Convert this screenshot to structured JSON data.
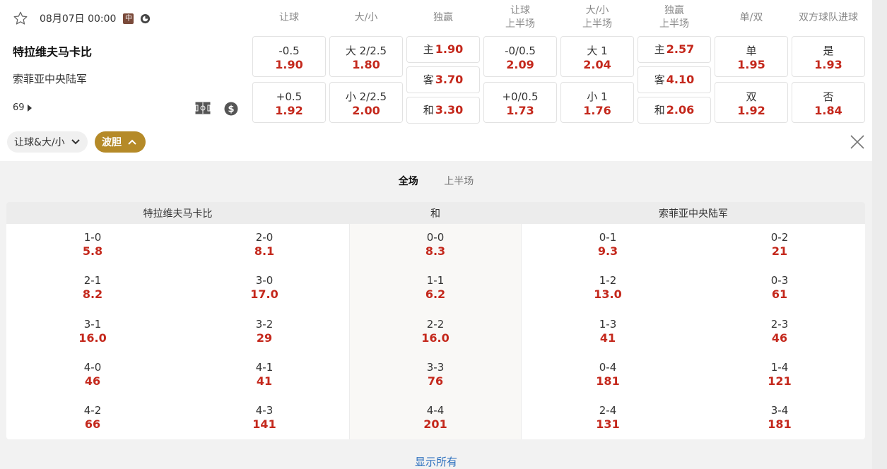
{
  "match": {
    "date": "08月07日 00:00",
    "badge": "中",
    "home": "特拉维夫马卡比",
    "away": "索菲亚中央陆军",
    "more_count": "69"
  },
  "columns": [
    {
      "line1": "让球",
      "line2": ""
    },
    {
      "line1": "大/小",
      "line2": ""
    },
    {
      "line1": "独赢",
      "line2": ""
    },
    {
      "line1": "让球",
      "line2": "上半场"
    },
    {
      "line1": "大/小",
      "line2": "上半场"
    },
    {
      "line1": "独赢",
      "line2": "上半场"
    },
    {
      "line1": "单/双",
      "line2": ""
    },
    {
      "line1": "双方球队进球",
      "line2": ""
    }
  ],
  "odds": {
    "handicap": [
      {
        "lab": "-0.5",
        "odd": "1.90"
      },
      {
        "lab": "+0.5",
        "odd": "1.92"
      }
    ],
    "over_under": [
      {
        "lab": "大 2/2.5",
        "odd": "1.80"
      },
      {
        "lab": "小 2/2.5",
        "odd": "2.00"
      }
    ],
    "moneyline": [
      {
        "lab": "主",
        "odd": "1.90"
      },
      {
        "lab": "客",
        "odd": "3.70"
      },
      {
        "lab": "和",
        "odd": "3.30"
      }
    ],
    "handicap_1h": [
      {
        "lab": "-0/0.5",
        "odd": "2.09"
      },
      {
        "lab": "+0/0.5",
        "odd": "1.73"
      }
    ],
    "over_under_1h": [
      {
        "lab": "大 1",
        "odd": "2.04"
      },
      {
        "lab": "小 1",
        "odd": "1.76"
      }
    ],
    "moneyline_1h": [
      {
        "lab": "主",
        "odd": "2.57"
      },
      {
        "lab": "客",
        "odd": "4.10"
      },
      {
        "lab": "和",
        "odd": "2.06"
      }
    ],
    "odd_even": [
      {
        "lab": "单",
        "odd": "1.95"
      },
      {
        "lab": "双",
        "odd": "1.92"
      }
    ],
    "btts": [
      {
        "lab": "是",
        "odd": "1.93"
      },
      {
        "lab": "否",
        "odd": "1.84"
      }
    ]
  },
  "filters": {
    "market_pill": "让球&大/小",
    "correct_score_pill": "波胆"
  },
  "tabs": {
    "full": "全场",
    "first_half": "上半场"
  },
  "correct_score": {
    "headers": {
      "home": "特拉维夫马卡比",
      "draw": "和",
      "away": "索菲亚中央陆军"
    },
    "columns": [
      [
        {
          "s": "1-0",
          "o": "5.8"
        },
        {
          "s": "2-1",
          "o": "8.2"
        },
        {
          "s": "3-1",
          "o": "16.0"
        },
        {
          "s": "4-0",
          "o": "46"
        },
        {
          "s": "4-2",
          "o": "66"
        }
      ],
      [
        {
          "s": "2-0",
          "o": "8.1"
        },
        {
          "s": "3-0",
          "o": "17.0"
        },
        {
          "s": "3-2",
          "o": "29"
        },
        {
          "s": "4-1",
          "o": "41"
        },
        {
          "s": "4-3",
          "o": "141"
        }
      ],
      [
        {
          "s": "0-0",
          "o": "8.3"
        },
        {
          "s": "1-1",
          "o": "6.2"
        },
        {
          "s": "2-2",
          "o": "16.0"
        },
        {
          "s": "3-3",
          "o": "76"
        },
        {
          "s": "4-4",
          "o": "201"
        }
      ],
      [
        {
          "s": "0-1",
          "o": "9.3"
        },
        {
          "s": "1-2",
          "o": "13.0"
        },
        {
          "s": "1-3",
          "o": "41"
        },
        {
          "s": "0-4",
          "o": "181"
        },
        {
          "s": "2-4",
          "o": "131"
        }
      ],
      [
        {
          "s": "0-2",
          "o": "21"
        },
        {
          "s": "0-3",
          "o": "61"
        },
        {
          "s": "2-3",
          "o": "46"
        },
        {
          "s": "1-4",
          "o": "121"
        },
        {
          "s": "3-4",
          "o": "181"
        }
      ]
    ]
  },
  "show_all": "显示所有",
  "colors": {
    "odds_red": "#c4281c",
    "accent_gold": "#b58a28",
    "link_blue": "#2b6fbe"
  }
}
